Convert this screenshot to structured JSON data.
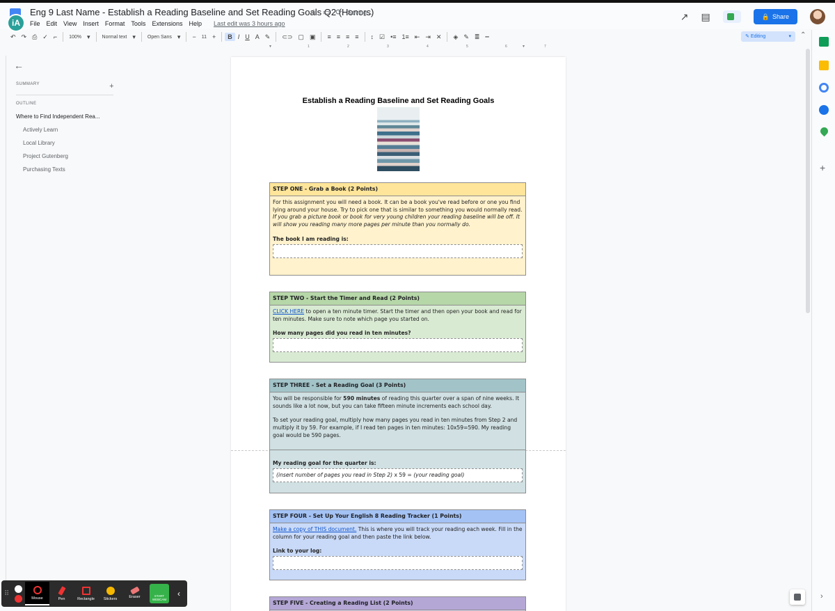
{
  "app": {
    "doc_title": "Eng 9 Last Name - Establish a Reading Baseline and Set Reading Goals Q2 (Honors)",
    "status": "Saving...",
    "last_edit": "Last edit was 3 hours ago",
    "badge": "iA",
    "menu": [
      "File",
      "Edit",
      "View",
      "Insert",
      "Format",
      "Tools",
      "Extensions",
      "Help"
    ],
    "share_label": "Share"
  },
  "toolbar": {
    "zoom": "100%",
    "style": "Normal text",
    "font": "Open Sans",
    "font_size": "11",
    "bold": "B",
    "italic": "I",
    "underline": "U",
    "text_color": "A",
    "mode": "Editing"
  },
  "ruler": [
    "1",
    "2",
    "3",
    "4",
    "5",
    "6",
    "7"
  ],
  "outline": {
    "summary_label": "SUMMARY",
    "outline_label": "OUTLINE",
    "h1": "Where to Find Independent Rea...",
    "items": [
      "Actively Learn",
      "Local Library",
      "Project Gutenberg",
      "Purchasing Texts"
    ]
  },
  "document": {
    "heading": "Establish a Reading Baseline and Set Reading Goals",
    "step1": {
      "title": "STEP ONE - Grab a Book (2 Points)",
      "body": "For this assignment you will need a book. It can be a book you've read before or one you find lying around your house. Try to pick one that is similar to something you would normally read.",
      "body_italic": "If you grab a picture book or book for very young children your reading baseline will be off. It will show you reading many more pages per minute than you normally do.",
      "question": "The book I am reading is:"
    },
    "step2": {
      "title": "STEP TWO - Start the Timer and Read (2 Points)",
      "link": "CLICK HERE",
      "body": "to open a ten minute timer. Start the timer and then open your book and read for ten minutes. Make sure to note which page you started on.",
      "question": "How many pages did you read in ten minutes?"
    },
    "step3": {
      "title": "STEP THREE - Set a Reading Goal (3 Points)",
      "body_a": "You will be responsible for",
      "body_bold": "590 minutes",
      "body_b": "of reading this quarter over a span of nine weeks. It sounds like a lot now, but you can take fifteen minute increments each school day.",
      "body2": "To set your reading goal, multiply how many pages you read in ten minutes from Step 2 and multiply it by 59. For example, if I read ten pages in ten minutes: 10x59=590. My reading goal would be 590 pages.",
      "question": "My reading goal for the quarter is:",
      "answer_a": "(insert number of pages you read in Step 2)",
      "answer_b": " x 59 = ",
      "answer_c": "(your reading goal)"
    },
    "step4": {
      "title": "STEP FOUR - Set Up Your English 8 Reading Tracker (1 Points)",
      "link": "Make a copy of THIS document.",
      "body": "This is where you will track your reading each week. Fill in the column for your reading goal and then paste the link below.",
      "question": "Link to your log:"
    },
    "step5": {
      "title": "STEP FIVE - Creating a Reading List (2 Points)"
    }
  },
  "annotation_toolbar": {
    "tools": [
      "Mouse",
      "Pen",
      "Rectangle",
      "Stickers",
      "Eraser"
    ],
    "webcam": "START WEBCAM"
  },
  "colors": {
    "step1": "#fff2cc",
    "step2": "#d9ead3",
    "step3": "#d0e0e3",
    "step4": "#c9daf8",
    "step5": "#d9d2e9",
    "share": "#1a73e8"
  }
}
